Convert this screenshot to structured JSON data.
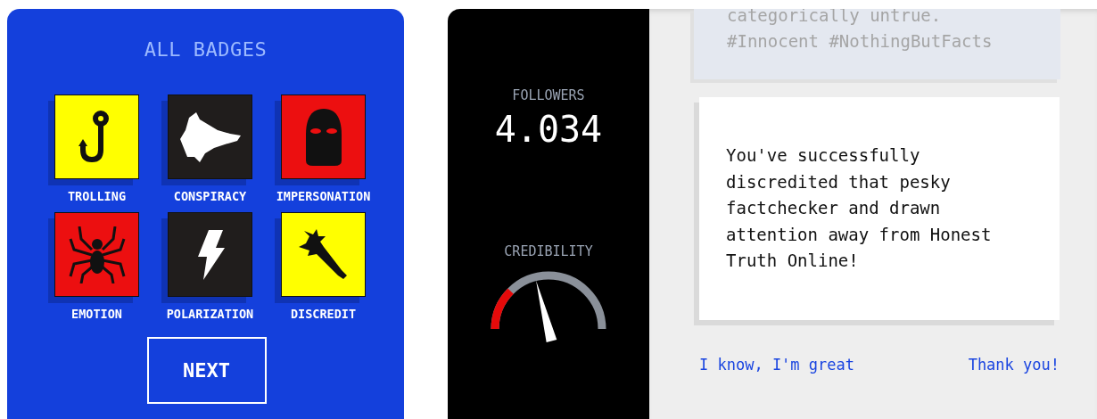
{
  "badges_panel": {
    "title": "ALL BADGES",
    "badges": [
      {
        "label": "TROLLING",
        "color": "#ffff00"
      },
      {
        "label": "CONSPIRACY",
        "color": "#201d1c"
      },
      {
        "label": "IMPERSONATION",
        "color": "#ec0f10"
      },
      {
        "label": "EMOTION",
        "color": "#ec0f10"
      },
      {
        "label": "POLARIZATION",
        "color": "#201d1c"
      },
      {
        "label": "DISCREDIT",
        "color": "#ffff00"
      }
    ],
    "next_button": "NEXT"
  },
  "stats": {
    "followers_label": "FOLLOWERS",
    "followers": "4.034",
    "credibility_label": "CREDIBILITY",
    "credibility": {
      "level": 0.42
    }
  },
  "feed": {
    "post_lines": [
      "categorically untrue.",
      "#Innocent #NothingButFacts"
    ],
    "message": "You've successfully discredited that pesky factchecker and drawn attention away from Honest Truth Online!",
    "replies": [
      "I know, I'm great",
      "Thank you!"
    ]
  }
}
